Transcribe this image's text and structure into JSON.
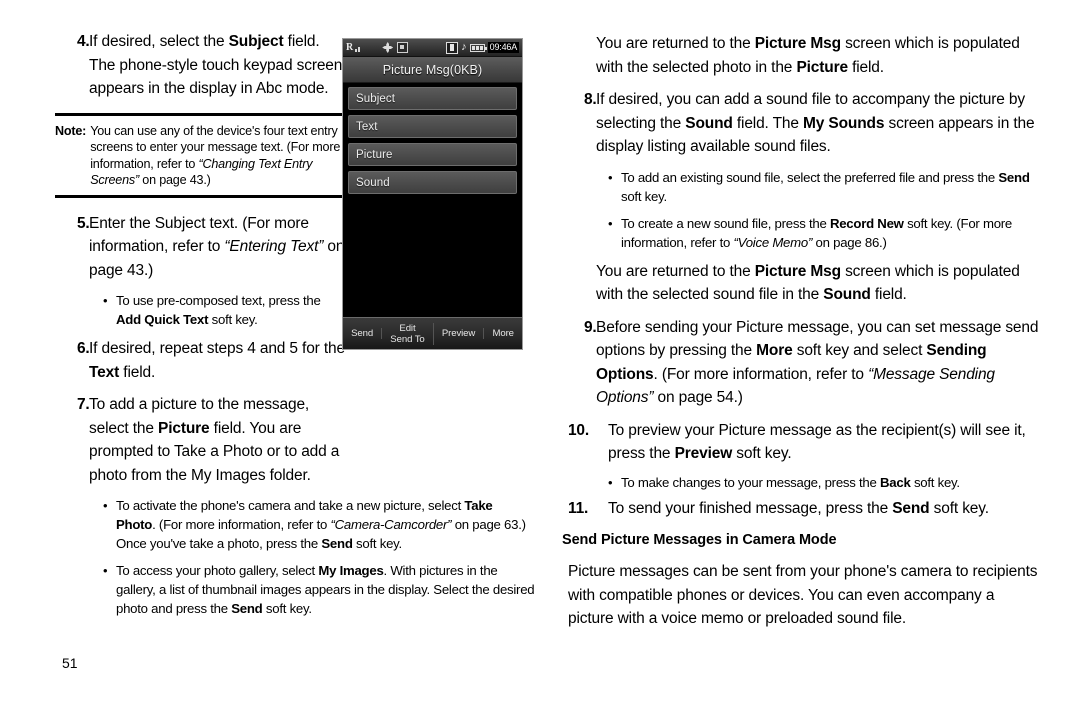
{
  "page": {
    "number": "51"
  },
  "left_column": {
    "step4": {
      "num": "4.",
      "parts": [
        {
          "t": "If desired, select the ",
          "s": "n"
        },
        {
          "t": "Subject",
          "s": "b"
        },
        {
          "t": " field. The phone-style touch keypad screen appears in the display in Abc mode.",
          "s": "n"
        }
      ]
    },
    "note": {
      "label": "Note:",
      "parts": [
        {
          "t": "You can use any of the device's four text entry screens to enter your message text. (For more information, refer to ",
          "s": "n"
        },
        {
          "t": "“Changing Text Entry Screens”",
          "s": "i"
        },
        {
          "t": " on page 43.)",
          "s": "n"
        }
      ]
    },
    "step5": {
      "num": "5.",
      "parts": [
        {
          "t": "Enter the Subject text. (For more information, refer to ",
          "s": "n"
        },
        {
          "t": "“Entering Text”",
          "s": "i"
        },
        {
          "t": " on page 43.)",
          "s": "n"
        }
      ],
      "bullets": [
        {
          "parts": [
            {
              "t": "To use pre-composed text, press the ",
              "s": "n"
            },
            {
              "t": "Add Quick Text",
              "s": "b"
            },
            {
              "t": " soft key.",
              "s": "n"
            }
          ]
        }
      ]
    },
    "step6": {
      "num": "6.",
      "parts": [
        {
          "t": "If desired, repeat steps 4 and 5 for the ",
          "s": "n"
        },
        {
          "t": "Text",
          "s": "b"
        },
        {
          "t": " field.",
          "s": "n"
        }
      ]
    },
    "step7": {
      "num": "7.",
      "parts": [
        {
          "t": "To add a picture to the message, select the ",
          "s": "n"
        },
        {
          "t": "Picture",
          "s": "b"
        },
        {
          "t": " field. You are prompted to Take a Photo or to add a photo from the My Images folder.",
          "s": "n"
        }
      ],
      "bullets": [
        {
          "parts": [
            {
              "t": "To activate the phone's camera and take a new picture, select ",
              "s": "n"
            },
            {
              "t": "Take Photo",
              "s": "b"
            },
            {
              "t": ". (For more information, refer to ",
              "s": "n"
            },
            {
              "t": "“Camera-Camcorder”",
              "s": "i"
            },
            {
              "t": " on page 63.) Once you've take a photo, press the ",
              "s": "n"
            },
            {
              "t": "Send",
              "s": "b"
            },
            {
              "t": " soft key.",
              "s": "n"
            }
          ]
        },
        {
          "parts": [
            {
              "t": "To access your photo gallery, select ",
              "s": "n"
            },
            {
              "t": "My Images",
              "s": "b"
            },
            {
              "t": ". With pictures in the gallery, a list of thumbnail images appears in the display. Select the desired photo and press the ",
              "s": "n"
            },
            {
              "t": "Send",
              "s": "b"
            },
            {
              "t": " soft key.",
              "s": "n"
            }
          ]
        }
      ]
    }
  },
  "right_column": {
    "intro_picture": {
      "parts": [
        {
          "t": "You are returned to the ",
          "s": "n"
        },
        {
          "t": "Picture Msg",
          "s": "b"
        },
        {
          "t": " screen which is populated with the selected photo in the ",
          "s": "n"
        },
        {
          "t": "Picture",
          "s": "b"
        },
        {
          "t": " field.",
          "s": "n"
        }
      ]
    },
    "step8": {
      "num": "8.",
      "parts": [
        {
          "t": "If desired, you can add a sound file to accompany the picture by selecting the ",
          "s": "n"
        },
        {
          "t": "Sound",
          "s": "b"
        },
        {
          "t": " field. The ",
          "s": "n"
        },
        {
          "t": "My Sounds",
          "s": "b"
        },
        {
          "t": " screen appears in the display listing available sound files.",
          "s": "n"
        }
      ],
      "bullets": [
        {
          "parts": [
            {
              "t": "To add an existing sound file, select the preferred file and press the ",
              "s": "n"
            },
            {
              "t": "Send",
              "s": "b"
            },
            {
              "t": " soft key.",
              "s": "n"
            }
          ]
        },
        {
          "parts": [
            {
              "t": "To create a new sound file, press the ",
              "s": "n"
            },
            {
              "t": "Record New",
              "s": "b"
            },
            {
              "t": " soft key. (For more information, refer to ",
              "s": "n"
            },
            {
              "t": "“Voice Memo”",
              "s": "i"
            },
            {
              "t": " on page 86.)",
              "s": "n"
            }
          ]
        }
      ]
    },
    "intro_sound": {
      "parts": [
        {
          "t": "You are returned to the ",
          "s": "n"
        },
        {
          "t": "Picture Msg",
          "s": "b"
        },
        {
          "t": " screen which is populated with the selected sound file in the ",
          "s": "n"
        },
        {
          "t": "Sound",
          "s": "b"
        },
        {
          "t": " field.",
          "s": "n"
        }
      ]
    },
    "step9": {
      "num": "9.",
      "parts": [
        {
          "t": "Before sending your Picture message, you can set message send options by pressing the ",
          "s": "n"
        },
        {
          "t": "More",
          "s": "b"
        },
        {
          "t": " soft key and select ",
          "s": "n"
        },
        {
          "t": "Sending Options",
          "s": "b"
        },
        {
          "t": ". (For more information, refer to ",
          "s": "n"
        },
        {
          "t": "“Message Sending Options”",
          "s": "i"
        },
        {
          "t": " on page 54.)",
          "s": "n"
        }
      ]
    },
    "step10": {
      "num": "10.",
      "parts": [
        {
          "t": "To preview your Picture message as the recipient(s) will see it, press the ",
          "s": "n"
        },
        {
          "t": "Preview",
          "s": "b"
        },
        {
          "t": " soft key.",
          "s": "n"
        }
      ],
      "bullets": [
        {
          "parts": [
            {
              "t": "To make changes to your message, press the ",
              "s": "n"
            },
            {
              "t": "Back",
              "s": "b"
            },
            {
              "t": " soft key.",
              "s": "n"
            }
          ]
        }
      ]
    },
    "step11": {
      "num": "11.",
      "parts": [
        {
          "t": "To send your finished message, press the ",
          "s": "n"
        },
        {
          "t": "Send",
          "s": "b"
        },
        {
          "t": " soft key.",
          "s": "n"
        }
      ]
    },
    "section_heading": "Send Picture Messages in Camera Mode",
    "closing_paragraph": {
      "parts": [
        {
          "t": "Picture messages can be sent from your phone's camera to recipients with compatible phones or devices. You can even accompany a picture with a voice memo or preloaded sound file.",
          "s": "n"
        }
      ]
    }
  },
  "phone_screenshot": {
    "status_bar": {
      "roaming_icon": "roaming-r-icon",
      "signal_icon": "signal-bars-icon",
      "gps_icon": "gps-icon",
      "tty_icon": "tty-box-icon",
      "picture_icon": "picture-message-icon",
      "sound_icon": "music-note-icon",
      "battery_icon": "battery-icon",
      "clock": "09:46A"
    },
    "title": "Picture Msg(0KB)",
    "rows": [
      {
        "label": "Subject"
      },
      {
        "label": "Text"
      },
      {
        "label": "Picture"
      },
      {
        "label": "Sound"
      }
    ],
    "softkeys": [
      {
        "line1": "Send",
        "line2": ""
      },
      {
        "line1": "Edit",
        "line2": "Send To"
      },
      {
        "line1": "Preview",
        "line2": ""
      },
      {
        "line1": "More",
        "line2": ""
      }
    ]
  }
}
